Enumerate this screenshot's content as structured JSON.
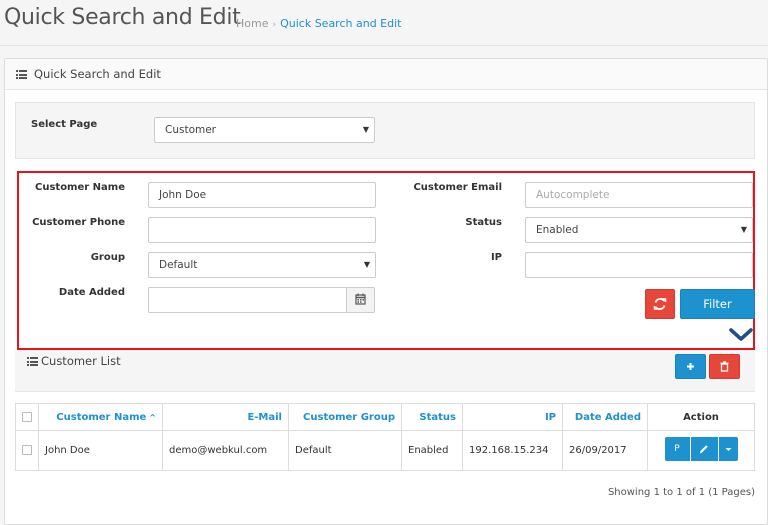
{
  "page": {
    "title": "Quick Search and Edit",
    "breadcrumb": {
      "home": "Home",
      "current": "Quick Search and Edit"
    }
  },
  "panel": {
    "title": "Quick Search and Edit"
  },
  "select_page": {
    "label": "Select Page",
    "value": "Customer"
  },
  "filters": {
    "customer_name": {
      "label": "Customer Name",
      "value": "John Doe"
    },
    "customer_email": {
      "label": "Customer Email",
      "placeholder": "Autocomplete"
    },
    "customer_phone": {
      "label": "Customer Phone",
      "value": ""
    },
    "status": {
      "label": "Status",
      "value": "Enabled"
    },
    "group": {
      "label": "Group",
      "value": "Default"
    },
    "ip": {
      "label": "IP",
      "value": ""
    },
    "date_added": {
      "label": "Date Added",
      "value": ""
    },
    "filter_label": "Filter"
  },
  "customer_list": {
    "title": "Customer List",
    "columns": [
      "Customer Name",
      "E-Mail",
      "Customer Group",
      "Status",
      "IP",
      "Date Added",
      "Action"
    ],
    "rows": [
      {
        "name": "John Doe",
        "email": "demo@webkul.com",
        "group": "Default",
        "status": "Enabled",
        "ip": "192.168.15.234",
        "date_added": "26/09/2017"
      }
    ],
    "action_p": "P",
    "showing": "Showing 1 to 1 of 1 (1 Pages)"
  },
  "colors": {
    "accent": "#1e91cf",
    "danger": "#e7463a",
    "highlight_border": "#e8141c"
  }
}
